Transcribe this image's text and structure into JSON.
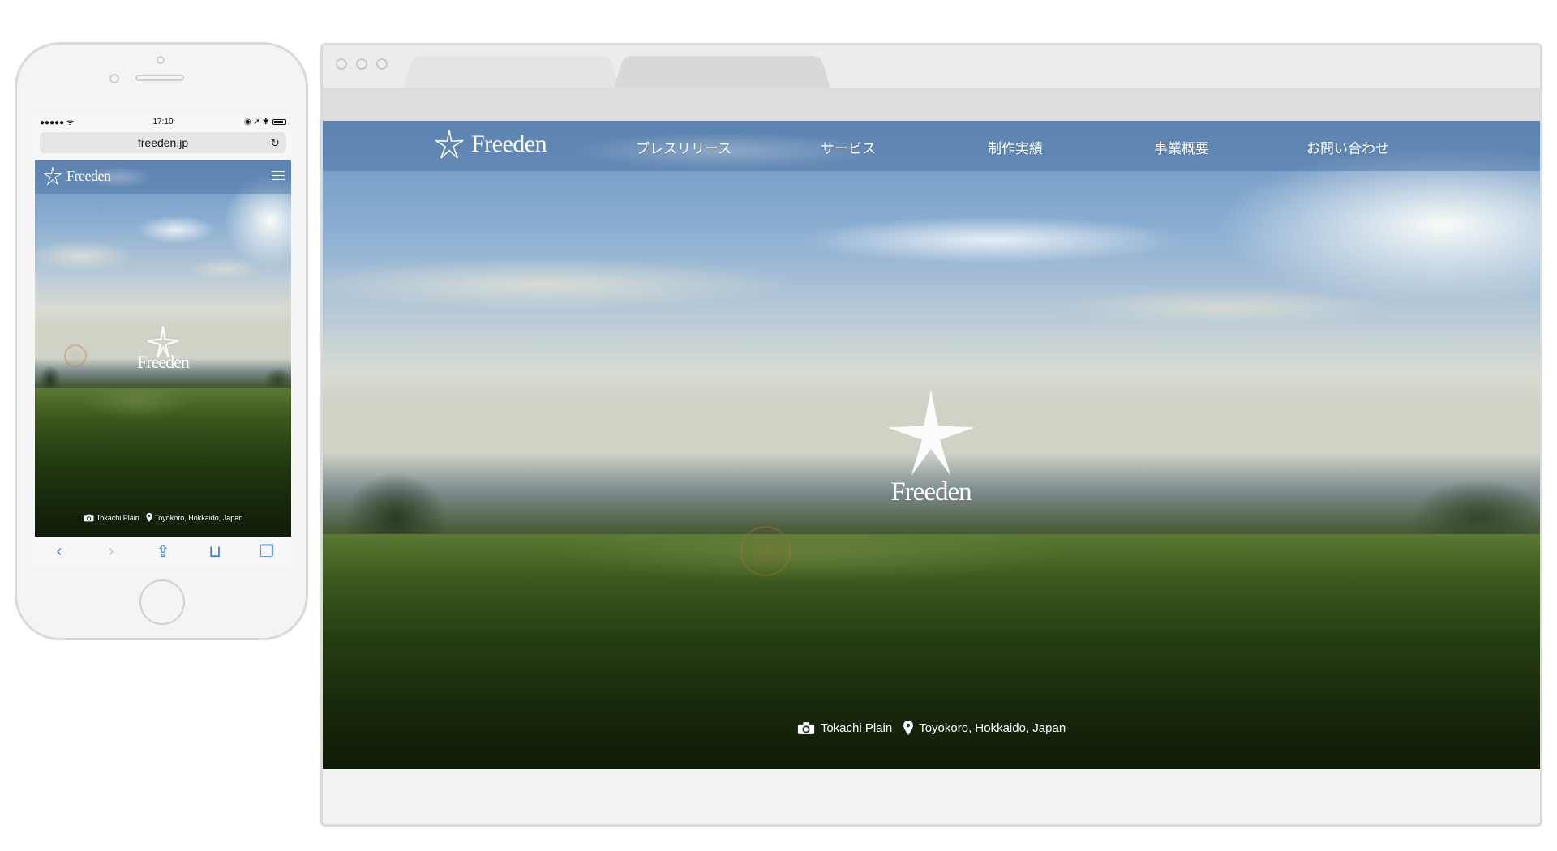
{
  "site": {
    "brand": "Freeden",
    "nav": [
      "プレスリリース",
      "サービス",
      "制作実績",
      "事業概要",
      "お問い合わせ"
    ],
    "credit": {
      "photo": "Tokachi Plain",
      "location": "Toyokoro, Hokkaido, Japan"
    }
  },
  "phone": {
    "status": {
      "signal": "●●●●● ᯤ",
      "time": "17:10",
      "right": "◉ ➚ ✱"
    },
    "url": "freeden.jp",
    "reload_icon": "↻",
    "toolbar_icons": [
      "back-icon",
      "forward-icon",
      "share-icon",
      "bookmarks-icon",
      "tabs-icon"
    ],
    "toolbar_glyphs": [
      "‹",
      "›",
      "⇪",
      "⊔",
      "❐"
    ]
  },
  "colors": {
    "nav_overlay": "#466ea0",
    "browser_chrome": "#ececec",
    "safari_blue": "#2f7bf5"
  }
}
